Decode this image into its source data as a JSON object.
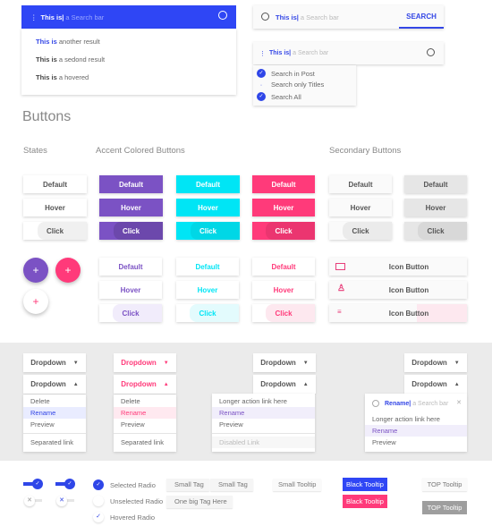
{
  "colors": {
    "blue": "#2f46f5",
    "purple": "#7b52c4",
    "cyan": "#00e5f5",
    "pink": "#ff3a7a",
    "gray_band": "#ebebeb"
  },
  "search1": {
    "typed": "This is|",
    "placeholder": "a Search bar",
    "icon": "search-icon",
    "results": [
      {
        "bold": "This is",
        "rest": " another result"
      },
      {
        "bold": "This is",
        "rest": " a sedond result"
      },
      {
        "bold": "This is",
        "rest": " a hovered"
      }
    ]
  },
  "search2": {
    "typed": "This is|",
    "placeholder": "a Search bar",
    "button": "SEARCH"
  },
  "search3": {
    "typed": "This is|",
    "placeholder": "a Search bar",
    "options": [
      {
        "label": "Search in Post",
        "checked": true
      },
      {
        "label": "Search only Titles",
        "checked": false
      },
      {
        "label": "Search All",
        "checked": true
      }
    ]
  },
  "buttons": {
    "heading": "Buttons",
    "states_label": "Accent Colored Buttons",
    "states": "States",
    "secondary": "Secondary Buttons",
    "default": "Default",
    "hover": "Hover",
    "click": "Click",
    "fab": "+",
    "icon_button": "Icon Button"
  },
  "dropdowns": {
    "label": "Dropdown",
    "menu1": [
      "Delete",
      "Rename",
      "Preview",
      "Separated link"
    ],
    "menu3": [
      "Longer action link here",
      "Rename",
      "Preview",
      "Disabled Link"
    ],
    "menu4": {
      "typed": "Rename|",
      "placeholder": "a Search bar",
      "items": [
        "Longer action link here",
        "Rename",
        "Preview"
      ]
    }
  },
  "controls": {
    "radios": [
      "Selected Radio",
      "Unselected Radio",
      "Hovered Radio"
    ],
    "tags": [
      "Small Tag",
      "Small Tag",
      "One big Tag Here"
    ],
    "tooltips": {
      "small": "Small Tooltip",
      "black1": "Black Tooltip",
      "black2": "Black Tooltip",
      "top1": "TOP Tooltip",
      "top2": "TOP Tooltip"
    }
  }
}
